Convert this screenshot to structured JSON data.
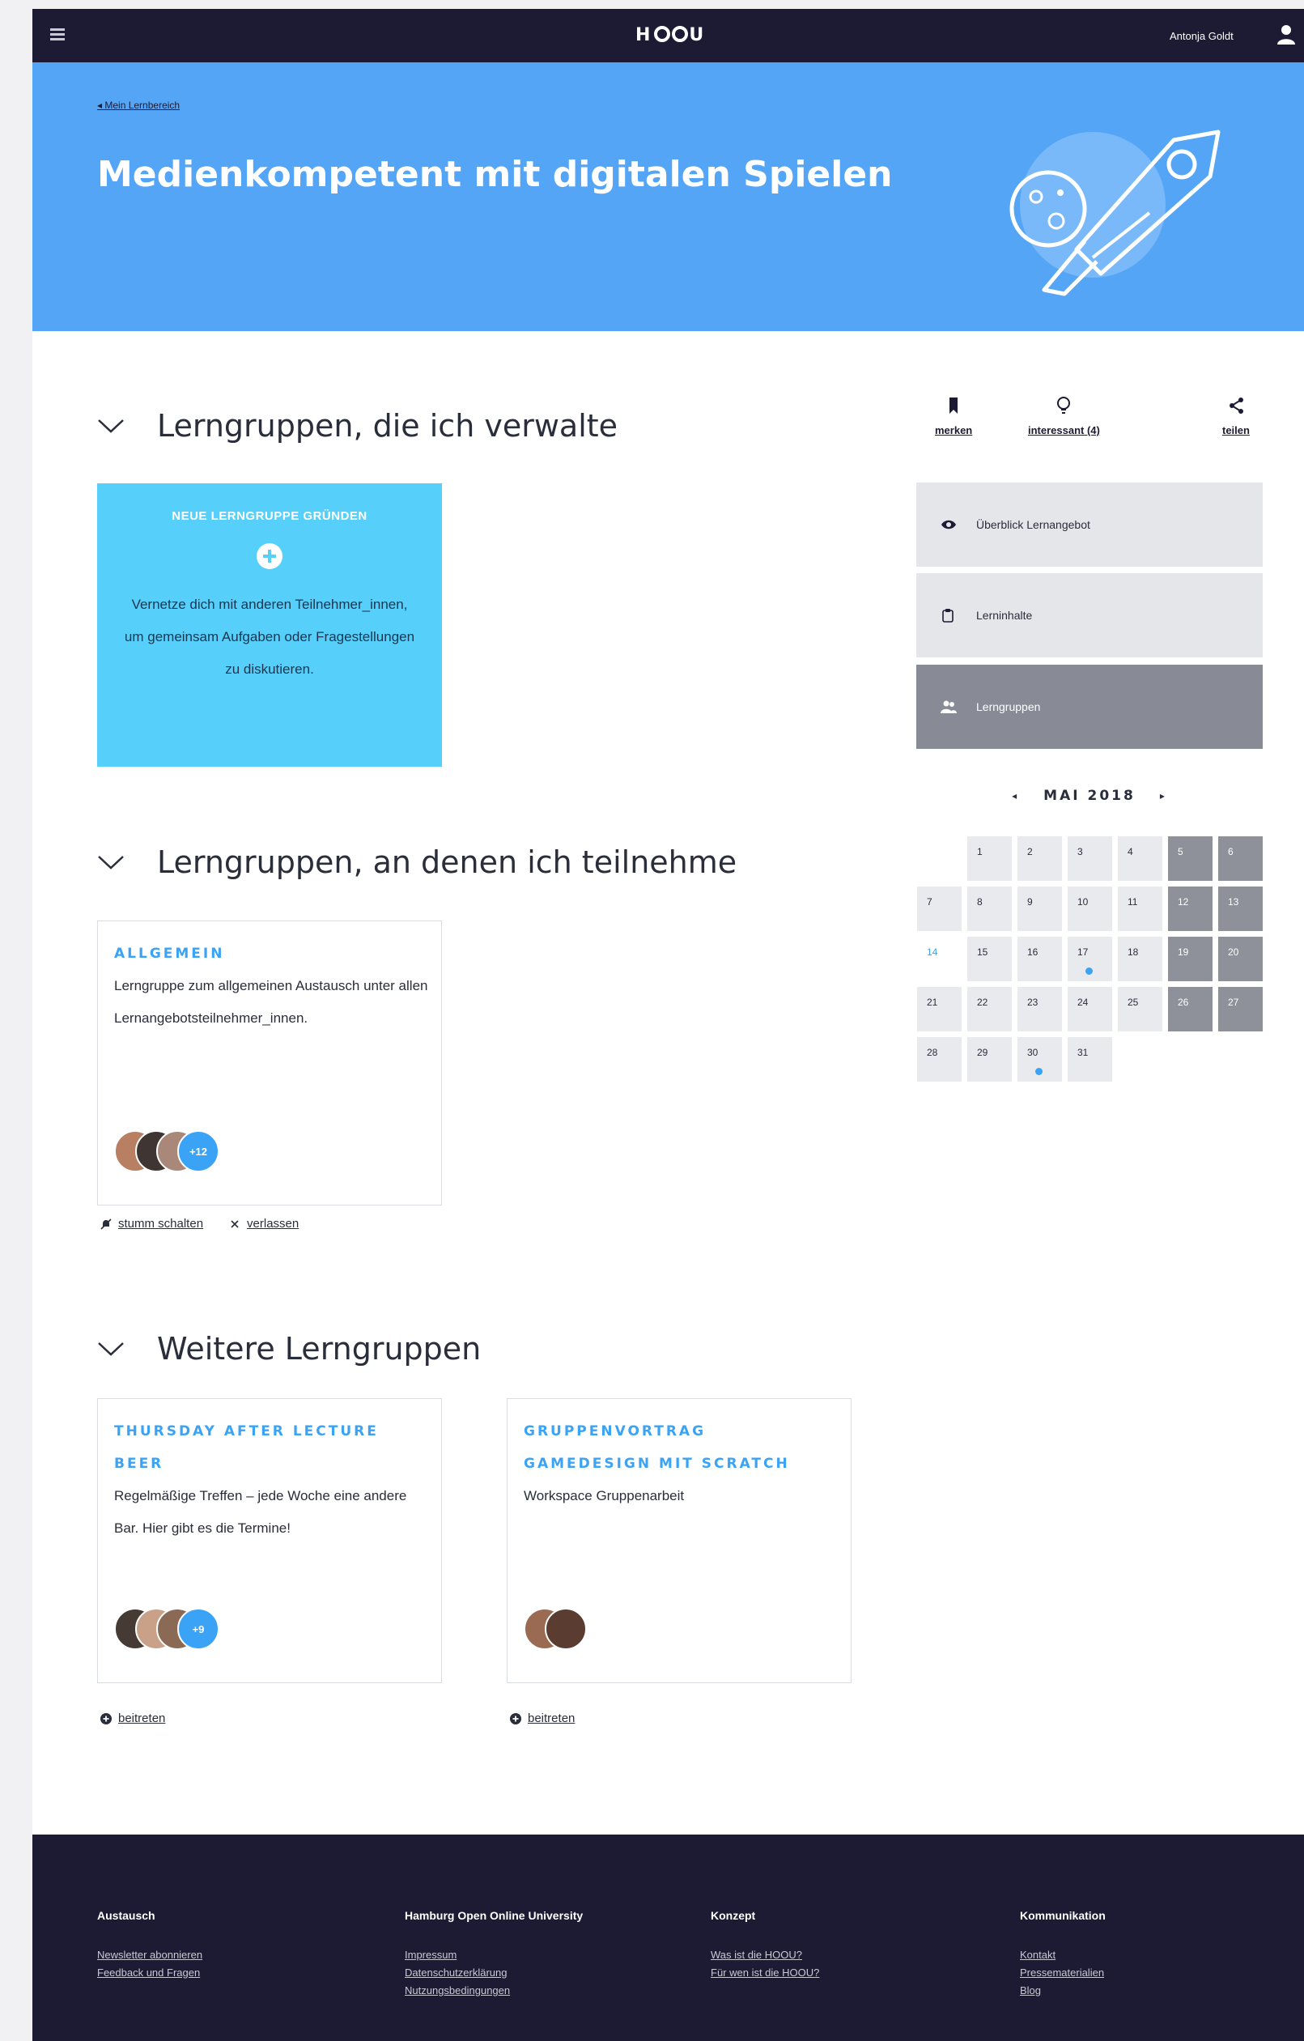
{
  "header": {
    "logo": "HOOU",
    "user_name": "Antonja Goldt"
  },
  "hero": {
    "breadcrumb": "Mein Lernbereich",
    "title": "Medienkompetent mit digitalen Spielen"
  },
  "sections": {
    "managed": {
      "title": "Lerngruppen, die ich verwalte",
      "new_group": {
        "title": "NEUE LERNGRUPPE GRÜNDEN",
        "text": "Vernetze dich mit anderen Teilnehmer_innen, um gemeinsam Aufgaben oder Fragestellungen zu diskutieren."
      }
    },
    "participating": {
      "title": "Lerngruppen, an denen ich teilnehme",
      "card": {
        "title": "ALLGEMEIN",
        "desc": "Lerngruppe zum allgemeinen Austausch unter allen Lernangebotsteilnehmer_innen.",
        "more_count": "+12",
        "mute_label": "stumm schalten",
        "leave_label": "verlassen"
      }
    },
    "more": {
      "title": "Weitere Lerngruppen",
      "cards": [
        {
          "title": "THURSDAY AFTER LECTURE BEER",
          "desc": "Regelmäßige Treffen – jede Woche eine andere Bar. Hier gibt es die Termine!",
          "more_count": "+9",
          "join_label": "beitreten"
        },
        {
          "title": "GRUPPENVORTRAG GAMEDESIGN MIT SCRATCH",
          "desc": "Workspace Gruppenarbeit",
          "join_label": "beitreten"
        }
      ]
    }
  },
  "sidebar": {
    "actions": {
      "bookmark": "merken",
      "interesting": "interessant (4)",
      "share": "teilen"
    },
    "nav": [
      {
        "label": "Überblick Lernangebot",
        "icon": "eye-icon"
      },
      {
        "label": "Lerninhalte",
        "icon": "clipboard-icon"
      },
      {
        "label": "Lerngruppen",
        "icon": "group-icon",
        "active": true
      }
    ],
    "calendar": {
      "month": "MAI 2018",
      "weeks": [
        [
          "",
          "1",
          "2",
          "3",
          "4",
          "5",
          "6"
        ],
        [
          "7",
          "8",
          "9",
          "10",
          "11",
          "12",
          "13"
        ],
        [
          "14",
          "15",
          "16",
          "17",
          "18",
          "19",
          "20"
        ],
        [
          "21",
          "22",
          "23",
          "24",
          "25",
          "26",
          "27"
        ],
        [
          "28",
          "29",
          "30",
          "31",
          "",
          "",
          ""
        ]
      ],
      "today": "14",
      "event_days": [
        "17",
        "30"
      ],
      "colors": {
        "weekend": "#8e9199",
        "weekday": "#e9eaee",
        "event_dot": "#3aa3f5"
      }
    }
  },
  "footer": {
    "columns": [
      {
        "title": "Austausch",
        "links": [
          "Newsletter abonnieren",
          "Feedback und Fragen"
        ]
      },
      {
        "title": "Hamburg Open Online University",
        "links": [
          "Impressum",
          "Datenschutzerklärung",
          "Nutzungsbedingungen"
        ]
      },
      {
        "title": "Konzept",
        "links": [
          "Was ist die HOOU?",
          "Für wen ist die HOOU?"
        ]
      },
      {
        "title": "Kommunikation",
        "links": [
          "Kontakt",
          "Pressematerialien",
          "Blog"
        ]
      }
    ]
  },
  "colors": {
    "navy": "#1c1b33",
    "hero_blue": "#55a5f7",
    "cyan": "#56d0fa",
    "accent": "#3aa3f5"
  }
}
